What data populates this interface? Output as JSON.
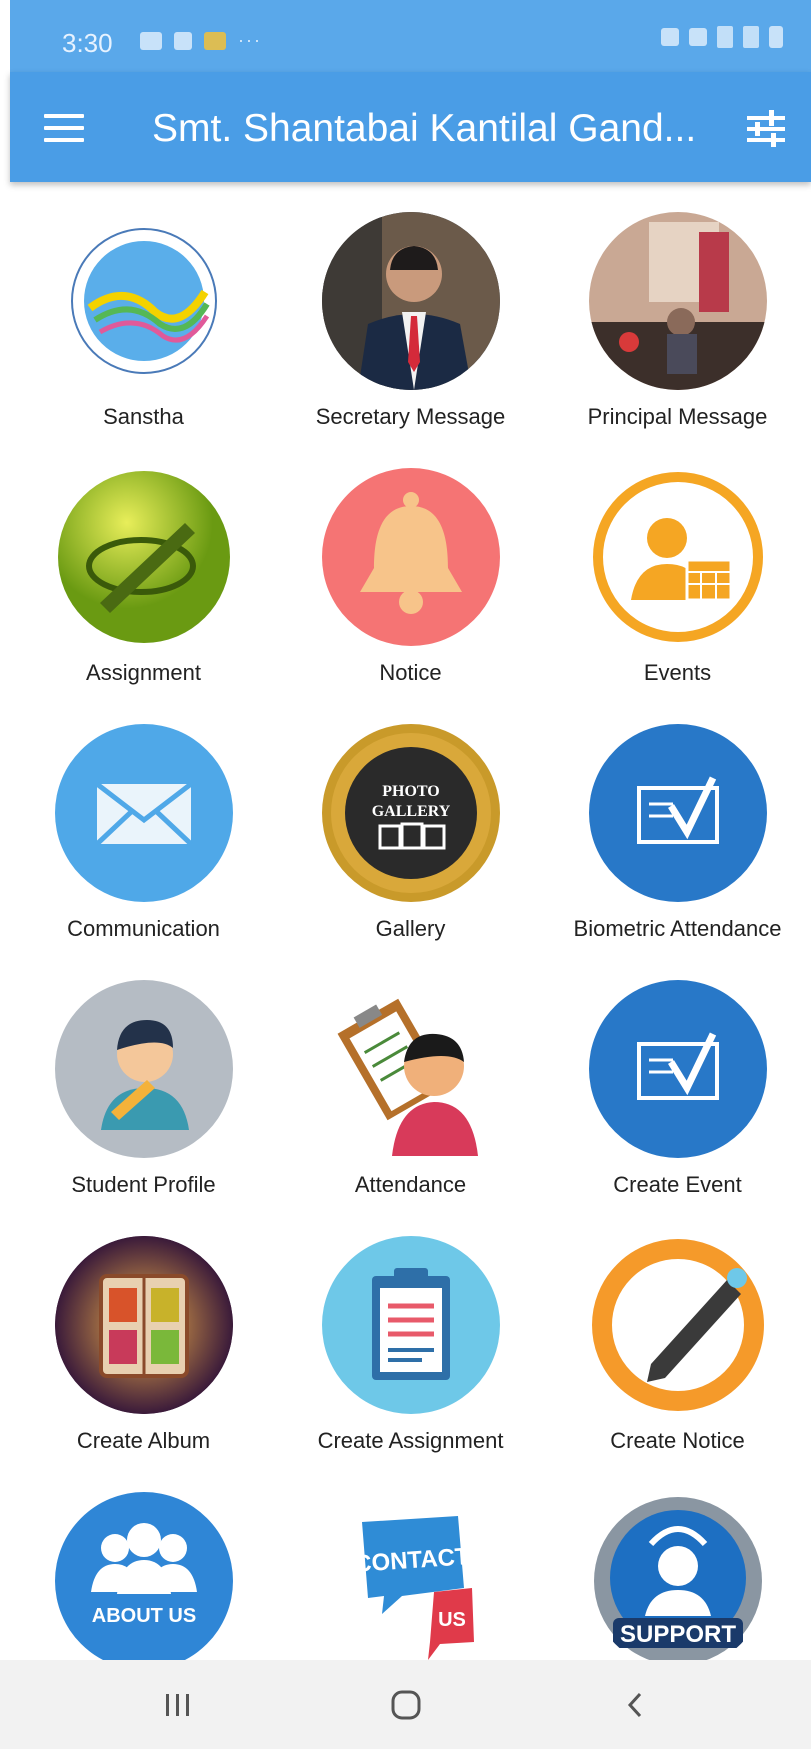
{
  "status_bar": {
    "time": "3:30"
  },
  "app_bar": {
    "title": "Smt. Shantabai Kantilal Gand...",
    "menu_icon": "hamburger-menu-icon",
    "filter_icon": "filter-sliders-icon"
  },
  "tiles": [
    {
      "label": "Sanstha",
      "icon": "sanstha-logo-icon"
    },
    {
      "label": "Secretary Message",
      "icon": "secretary-photo-icon"
    },
    {
      "label": "Principal Message",
      "icon": "principal-photo-icon"
    },
    {
      "label": "Assignment",
      "icon": "assignment-pencil-icon"
    },
    {
      "label": "Notice",
      "icon": "bell-icon"
    },
    {
      "label": "Events",
      "icon": "events-calendar-icon"
    },
    {
      "label": "Communication",
      "icon": "envelope-icon"
    },
    {
      "label": "Gallery",
      "icon": "photo-gallery-icon"
    },
    {
      "label": "Biometric Attendance",
      "icon": "checkmark-card-icon"
    },
    {
      "label": "Student Profile",
      "icon": "student-avatar-icon"
    },
    {
      "label": "Attendance",
      "icon": "clipboard-person-icon"
    },
    {
      "label": "Create Event",
      "icon": "checkmark-card-icon"
    },
    {
      "label": "Create Album",
      "icon": "album-book-icon"
    },
    {
      "label": "Create Assignment",
      "icon": "clipboard-document-icon"
    },
    {
      "label": "Create Notice",
      "icon": "pencil-ring-icon"
    },
    {
      "label": "",
      "icon": "about-us-icon",
      "badge_text": "ABOUT US"
    },
    {
      "label": "",
      "icon": "contact-us-icon",
      "badge_text_1": "CONTACT",
      "badge_text_2": "US"
    },
    {
      "label": "",
      "icon": "support-headset-icon",
      "badge_text": "SUPPORT"
    }
  ],
  "gallery_badge": {
    "line1": "PHOTO",
    "line2": "GALLERY"
  },
  "nav_bar": {
    "recents_icon": "recent-apps-icon",
    "home_icon": "home-icon",
    "back_icon": "back-icon"
  },
  "colors": {
    "app_bar": "#4a9de6",
    "status_bar": "#5aa8ea",
    "notice": "#f57474",
    "events_ring": "#f5a623",
    "communication": "#4fa8e8",
    "biometric": "#2878c8",
    "create_notice_ring": "#f59a2a",
    "support_blue": "#1d6fc2"
  }
}
